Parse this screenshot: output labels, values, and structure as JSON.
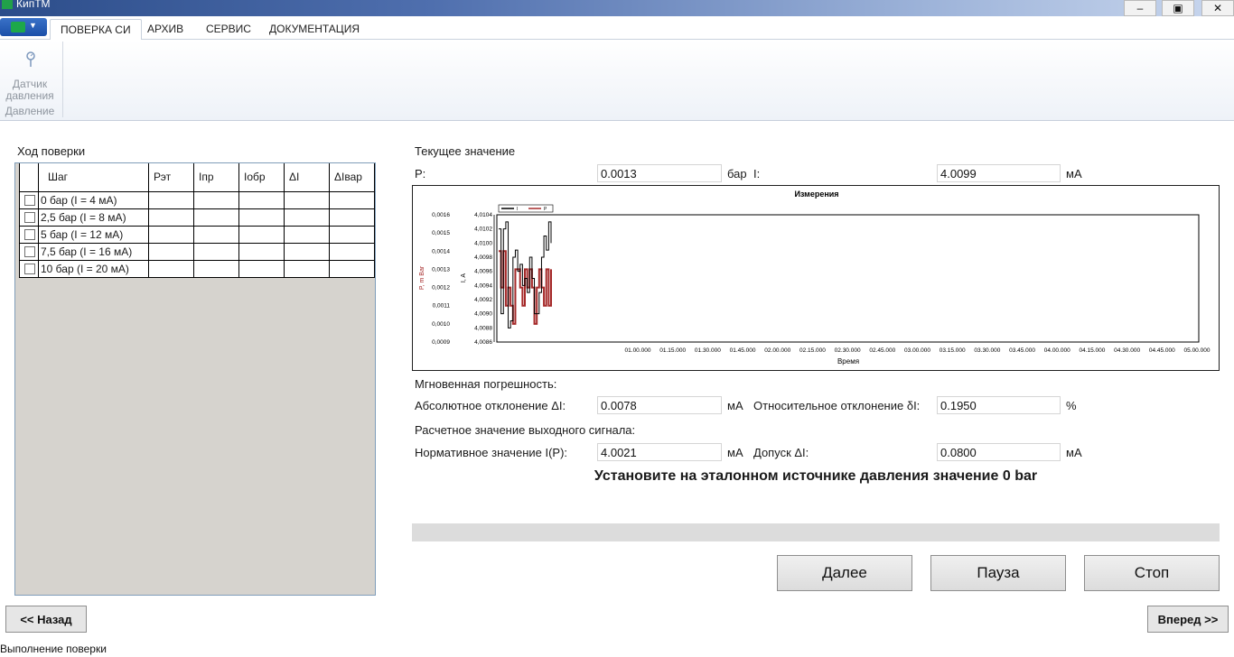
{
  "window": {
    "title": "КипТМ",
    "minimize": "–",
    "restore": "▣",
    "close": "✕"
  },
  "ribbon": {
    "tabs": [
      {
        "label": "ПОВЕРКА СИ",
        "active": true
      },
      {
        "label": "АРХИВ"
      },
      {
        "label": "СЕРВИС"
      },
      {
        "label": "ДОКУМЕНТАЦИЯ"
      }
    ],
    "group": {
      "button_line1": "Датчик",
      "button_line2": "давления",
      "caption": "Давление"
    }
  },
  "progress_panel": {
    "title": "Ход поверки",
    "columns": [
      "Шаг",
      "Рэт",
      "Iпр",
      "Iобр",
      "ΔI",
      "ΔIвар"
    ],
    "rows": [
      {
        "step": "0 бар (I = 4 мА)",
        "checked": false
      },
      {
        "step": "2,5 бар (I = 8 мА)",
        "checked": false
      },
      {
        "step": "5 бар (I = 12 мА)",
        "checked": false
      },
      {
        "step": "7,5 бар (I = 16 мА)",
        "checked": false
      },
      {
        "step": "10 бар (I = 20 мА)",
        "checked": false
      }
    ]
  },
  "current": {
    "title": "Текущее значение",
    "p_label": "P:",
    "p_value": "0.0013",
    "p_unit": "бар",
    "i_label": "I:",
    "i_value": "4.0099",
    "i_unit": "мА"
  },
  "chart_data": {
    "type": "line",
    "title": "Измерения",
    "xlabel": "Время",
    "ylabel_left": "P, m Bar",
    "ylabel_right": "I, A",
    "legend": [
      "I",
      "P"
    ],
    "p_ticks": [
      "0,0016",
      "0,0015",
      "0,0014",
      "0,0013",
      "0,0012",
      "0,0011",
      "0,0010",
      "0,0009"
    ],
    "i_ticks": [
      "4,0104",
      "4,0102",
      "4,0100",
      "4,0098",
      "4,0096",
      "4,0094",
      "4,0092",
      "4,0090",
      "4,0088",
      "4,0086"
    ],
    "x_ticks": [
      "01.00.000",
      "01.15.000",
      "01.30.000",
      "01.45.000",
      "02.00.000",
      "02.15.000",
      "02.30.000",
      "02.45.000",
      "03.00.000",
      "03.15.000",
      "03.30.000",
      "03.45.000",
      "04.00.000",
      "04.15.000",
      "04.30.000",
      "04.45.000",
      "05.00.000"
    ],
    "p_ylim": [
      0.0009,
      0.0016
    ],
    "i_ylim": [
      4.0086,
      4.0104
    ],
    "series": [
      {
        "name": "I",
        "color": "#000000",
        "values": [
          4.0102,
          4.009,
          4.0102,
          4.0103,
          4.0088,
          4.0089,
          4.0098,
          4.0099,
          4.0096,
          4.0097,
          4.0094,
          4.0095,
          4.0093,
          4.0098,
          4.0095,
          4.009,
          4.009,
          4.0093,
          4.0098,
          4.0101,
          4.0099,
          4.0103,
          4.01
        ]
      },
      {
        "name": "P",
        "color": "#a52a2a",
        "values": [
          0.0014,
          0.0012,
          0.0014,
          0.0011,
          0.0012,
          0.0011,
          0.001,
          0.0013,
          0.0013,
          0.0012,
          0.0011,
          0.0013,
          0.0012,
          0.0013,
          0.0012,
          0.001,
          0.0012,
          0.0013,
          0.0012,
          0.0011,
          0.0013,
          0.0011,
          0.0013
        ]
      }
    ]
  },
  "instant": {
    "title": "Мгновенная погрешность:",
    "abs_label": "Абсолютное отклонение ΔI:",
    "abs_value": "0.0078",
    "abs_unit": "мА",
    "rel_label": "Относительное отклонение δI:",
    "rel_value": "0.1950",
    "rel_unit": "%"
  },
  "calc": {
    "title": "Расчетное значение выходного сигнала:",
    "norm_label": "Нормативное значение I(P):",
    "norm_value": "4.0021",
    "norm_unit": "мА",
    "tol_label": "Допуск ΔI:",
    "tol_value": "0.0800",
    "tol_unit": "мА"
  },
  "instruction": "Установите на эталонном источнике давления значение 0 bar",
  "progress_fraction": 0,
  "buttons": {
    "next": "Далее",
    "pause": "Пауза",
    "stop": "Стоп",
    "back": "<< Назад",
    "forward": "Вперед >>"
  },
  "status_text": "Выполнение поверки"
}
